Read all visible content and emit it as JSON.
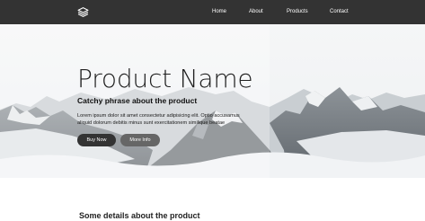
{
  "nav": {
    "logo_icon": "stacked-layers-icon",
    "links": [
      "Home",
      "About",
      "Products",
      "Contact"
    ]
  },
  "hero": {
    "title": "Product Name",
    "tagline": "Catchy phrase about the product",
    "body": "Lorem ipsum dolor sit amet consectetur adipisicing elit. Optio accusamus aliquid dolorum debitis minus sunt exercitationem similique beatae",
    "buttons": {
      "primary": "Buy Now",
      "secondary": "More Info"
    }
  },
  "section": {
    "heading": "Some details about the product"
  },
  "colors": {
    "navbar": "#333333",
    "primary_button": "#333333",
    "secondary_button": "#666666"
  }
}
